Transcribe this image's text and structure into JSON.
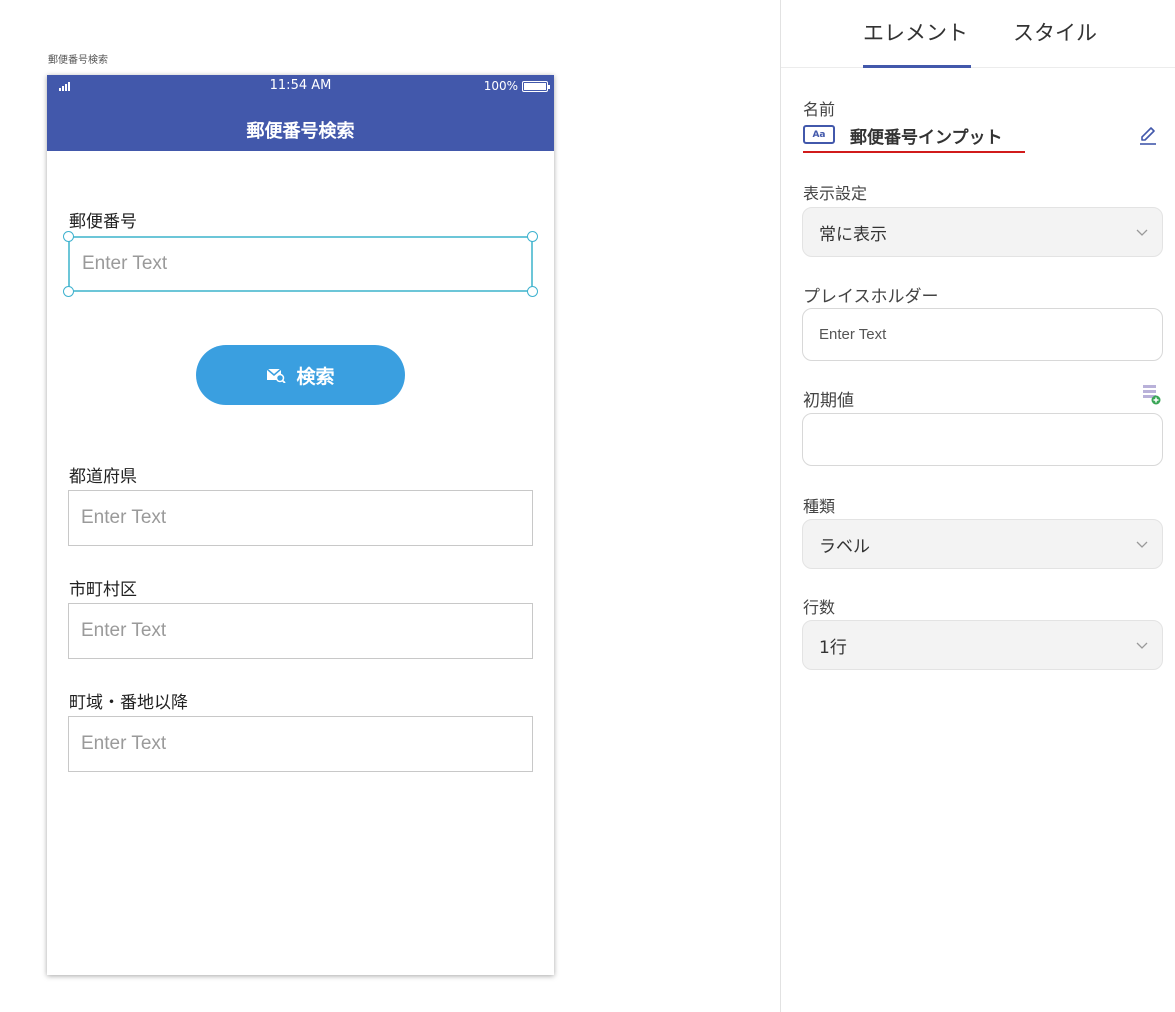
{
  "canvas": {
    "screen_caption": "郵便番号検索",
    "status_bar": {
      "time": "11:54 AM",
      "battery": "100%",
      "battery_level": 1.0
    },
    "app_title": "郵便番号検索",
    "fields": [
      {
        "label": "郵便番号",
        "placeholder": "Enter Text"
      },
      {
        "label": "都道府県",
        "placeholder": "Enter Text"
      },
      {
        "label": "市町村区",
        "placeholder": "Enter Text"
      },
      {
        "label": "町域・番地以降",
        "placeholder": "Enter Text"
      }
    ],
    "search_button_label": "検索"
  },
  "panel": {
    "tabs": [
      {
        "label": "エレメント",
        "active": true
      },
      {
        "label": "スタイル",
        "active": false
      }
    ],
    "name": {
      "label": "名前",
      "icon_text": "Aa",
      "value": "郵便番号インプット"
    },
    "visibility": {
      "label": "表示設定",
      "value": "常に表示"
    },
    "placeholder": {
      "label": "プレイスホルダー",
      "value": "Enter Text"
    },
    "initial_value": {
      "label": "初期値",
      "value": ""
    },
    "kind": {
      "label": "種類",
      "value": "ラベル"
    },
    "rows": {
      "label": "行数",
      "value": "1行"
    }
  },
  "colors": {
    "appbar": "#4258ab",
    "button": "#3a9fe0",
    "selection": "#6cc6d8",
    "accent": "#4258ab",
    "error_underline": "#d11b1b"
  }
}
